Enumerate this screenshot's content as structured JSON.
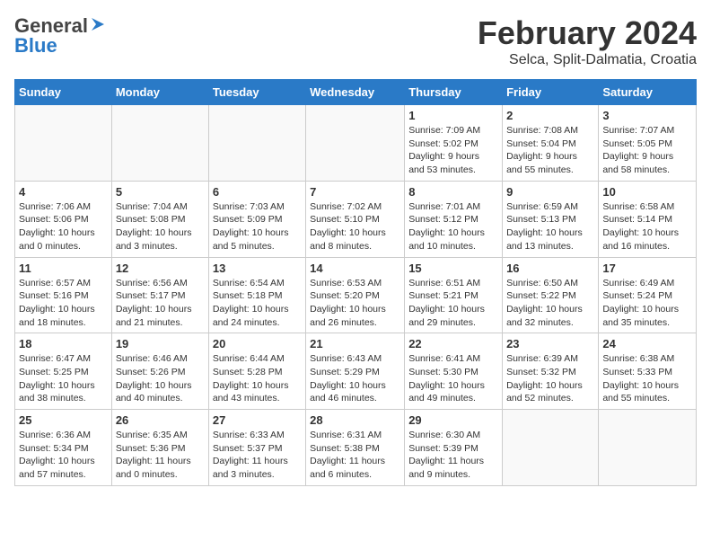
{
  "logo": {
    "general": "General",
    "blue": "Blue"
  },
  "title": "February 2024",
  "subtitle": "Selca, Split-Dalmatia, Croatia",
  "weekdays": [
    "Sunday",
    "Monday",
    "Tuesday",
    "Wednesday",
    "Thursday",
    "Friday",
    "Saturday"
  ],
  "weeks": [
    [
      {
        "num": "",
        "info": ""
      },
      {
        "num": "",
        "info": ""
      },
      {
        "num": "",
        "info": ""
      },
      {
        "num": "",
        "info": ""
      },
      {
        "num": "1",
        "info": "Sunrise: 7:09 AM\nSunset: 5:02 PM\nDaylight: 9 hours\nand 53 minutes."
      },
      {
        "num": "2",
        "info": "Sunrise: 7:08 AM\nSunset: 5:04 PM\nDaylight: 9 hours\nand 55 minutes."
      },
      {
        "num": "3",
        "info": "Sunrise: 7:07 AM\nSunset: 5:05 PM\nDaylight: 9 hours\nand 58 minutes."
      }
    ],
    [
      {
        "num": "4",
        "info": "Sunrise: 7:06 AM\nSunset: 5:06 PM\nDaylight: 10 hours\nand 0 minutes."
      },
      {
        "num": "5",
        "info": "Sunrise: 7:04 AM\nSunset: 5:08 PM\nDaylight: 10 hours\nand 3 minutes."
      },
      {
        "num": "6",
        "info": "Sunrise: 7:03 AM\nSunset: 5:09 PM\nDaylight: 10 hours\nand 5 minutes."
      },
      {
        "num": "7",
        "info": "Sunrise: 7:02 AM\nSunset: 5:10 PM\nDaylight: 10 hours\nand 8 minutes."
      },
      {
        "num": "8",
        "info": "Sunrise: 7:01 AM\nSunset: 5:12 PM\nDaylight: 10 hours\nand 10 minutes."
      },
      {
        "num": "9",
        "info": "Sunrise: 6:59 AM\nSunset: 5:13 PM\nDaylight: 10 hours\nand 13 minutes."
      },
      {
        "num": "10",
        "info": "Sunrise: 6:58 AM\nSunset: 5:14 PM\nDaylight: 10 hours\nand 16 minutes."
      }
    ],
    [
      {
        "num": "11",
        "info": "Sunrise: 6:57 AM\nSunset: 5:16 PM\nDaylight: 10 hours\nand 18 minutes."
      },
      {
        "num": "12",
        "info": "Sunrise: 6:56 AM\nSunset: 5:17 PM\nDaylight: 10 hours\nand 21 minutes."
      },
      {
        "num": "13",
        "info": "Sunrise: 6:54 AM\nSunset: 5:18 PM\nDaylight: 10 hours\nand 24 minutes."
      },
      {
        "num": "14",
        "info": "Sunrise: 6:53 AM\nSunset: 5:20 PM\nDaylight: 10 hours\nand 26 minutes."
      },
      {
        "num": "15",
        "info": "Sunrise: 6:51 AM\nSunset: 5:21 PM\nDaylight: 10 hours\nand 29 minutes."
      },
      {
        "num": "16",
        "info": "Sunrise: 6:50 AM\nSunset: 5:22 PM\nDaylight: 10 hours\nand 32 minutes."
      },
      {
        "num": "17",
        "info": "Sunrise: 6:49 AM\nSunset: 5:24 PM\nDaylight: 10 hours\nand 35 minutes."
      }
    ],
    [
      {
        "num": "18",
        "info": "Sunrise: 6:47 AM\nSunset: 5:25 PM\nDaylight: 10 hours\nand 38 minutes."
      },
      {
        "num": "19",
        "info": "Sunrise: 6:46 AM\nSunset: 5:26 PM\nDaylight: 10 hours\nand 40 minutes."
      },
      {
        "num": "20",
        "info": "Sunrise: 6:44 AM\nSunset: 5:28 PM\nDaylight: 10 hours\nand 43 minutes."
      },
      {
        "num": "21",
        "info": "Sunrise: 6:43 AM\nSunset: 5:29 PM\nDaylight: 10 hours\nand 46 minutes."
      },
      {
        "num": "22",
        "info": "Sunrise: 6:41 AM\nSunset: 5:30 PM\nDaylight: 10 hours\nand 49 minutes."
      },
      {
        "num": "23",
        "info": "Sunrise: 6:39 AM\nSunset: 5:32 PM\nDaylight: 10 hours\nand 52 minutes."
      },
      {
        "num": "24",
        "info": "Sunrise: 6:38 AM\nSunset: 5:33 PM\nDaylight: 10 hours\nand 55 minutes."
      }
    ],
    [
      {
        "num": "25",
        "info": "Sunrise: 6:36 AM\nSunset: 5:34 PM\nDaylight: 10 hours\nand 57 minutes."
      },
      {
        "num": "26",
        "info": "Sunrise: 6:35 AM\nSunset: 5:36 PM\nDaylight: 11 hours\nand 0 minutes."
      },
      {
        "num": "27",
        "info": "Sunrise: 6:33 AM\nSunset: 5:37 PM\nDaylight: 11 hours\nand 3 minutes."
      },
      {
        "num": "28",
        "info": "Sunrise: 6:31 AM\nSunset: 5:38 PM\nDaylight: 11 hours\nand 6 minutes."
      },
      {
        "num": "29",
        "info": "Sunrise: 6:30 AM\nSunset: 5:39 PM\nDaylight: 11 hours\nand 9 minutes."
      },
      {
        "num": "",
        "info": ""
      },
      {
        "num": "",
        "info": ""
      }
    ]
  ]
}
